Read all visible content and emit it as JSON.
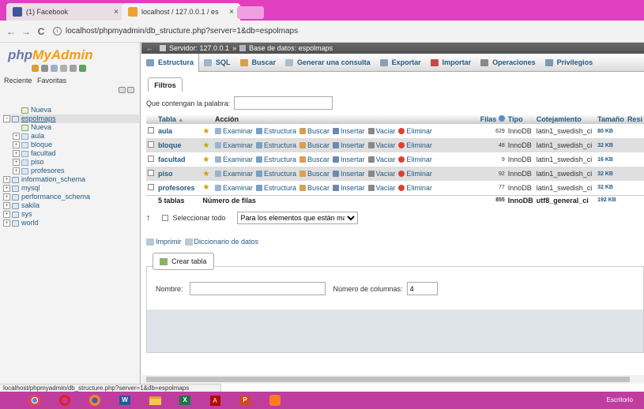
{
  "browser": {
    "tabs": [
      {
        "title": "(1) Facebook",
        "icon": "facebook-icon",
        "close": "×"
      },
      {
        "title": "localhost / 127.0.0.1 / es",
        "icon": "phpmyadmin-icon",
        "close": "×"
      }
    ],
    "url": "localhost/phpmyadmin/db_structure.php?server=1&db=espolmaps",
    "back": "←",
    "forward": "→",
    "reload": "C",
    "info": "i"
  },
  "nav": {
    "logo_php": "php",
    "logo_myadmin": "MyAdmin",
    "recent_label": "Reciente",
    "favorites_label": "Favoritas",
    "tree": [
      {
        "label": "Nueva",
        "level": 1,
        "expander": "",
        "type": "new"
      },
      {
        "label": "espolmaps",
        "level": 1,
        "expander": "−",
        "type": "db",
        "selected": true
      },
      {
        "label": "Nueva",
        "level": 2,
        "expander": "",
        "type": "new"
      },
      {
        "label": "aula",
        "level": 2,
        "expander": "+",
        "type": "table"
      },
      {
        "label": "bloque",
        "level": 2,
        "expander": "+",
        "type": "table"
      },
      {
        "label": "facultad",
        "level": 2,
        "expander": "+",
        "type": "table"
      },
      {
        "label": "piso",
        "level": 2,
        "expander": "+",
        "type": "table"
      },
      {
        "label": "profesores",
        "level": 2,
        "expander": "+",
        "type": "table"
      },
      {
        "label": "information_schema",
        "level": 1,
        "expander": "+",
        "type": "db"
      },
      {
        "label": "mysql",
        "level": 1,
        "expander": "+",
        "type": "db"
      },
      {
        "label": "performance_schema",
        "level": 1,
        "expander": "+",
        "type": "db"
      },
      {
        "label": "sakila",
        "level": 1,
        "expander": "+",
        "type": "db"
      },
      {
        "label": "sys",
        "level": 1,
        "expander": "+",
        "type": "db"
      },
      {
        "label": "world",
        "level": 1,
        "expander": "+",
        "type": "db"
      }
    ]
  },
  "breadcrumb": {
    "server": "Servidor: 127.0.0.1",
    "sep": "»",
    "database": "Base de datos: espolmaps"
  },
  "menu": [
    {
      "label": "Estructura",
      "active": true,
      "icon": "structure-icon",
      "color": "#7aa0c4"
    },
    {
      "label": "SQL",
      "active": false,
      "icon": "sql-icon",
      "color": "#9cb6cf"
    },
    {
      "label": "Buscar",
      "active": false,
      "icon": "search-icon",
      "color": "#d8a050"
    },
    {
      "label": "Generar una consulta",
      "active": false,
      "icon": "query-icon",
      "color": "#b0bcc8"
    },
    {
      "label": "Exportar",
      "active": false,
      "icon": "export-icon",
      "color": "#8aa0b8"
    },
    {
      "label": "Importar",
      "active": false,
      "icon": "import-icon",
      "color": "#c84848"
    },
    {
      "label": "Operaciones",
      "active": false,
      "icon": "wrench-icon",
      "color": "#8a8a8a"
    },
    {
      "label": "Privilegios",
      "active": false,
      "icon": "privileges-icon",
      "color": "#7a9ab8"
    }
  ],
  "filters": {
    "legend": "Filtros",
    "label": "Que contengan la palabra:",
    "value": ""
  },
  "table": {
    "headers": {
      "name": "Tabla",
      "sort_arrow": "▲",
      "action": "Acción",
      "rows": "Filas",
      "type": "Tipo",
      "collation": "Cotejamiento",
      "size": "Tamaño",
      "overhead": "Resi"
    },
    "actions": {
      "browse": "Examinar",
      "structure": "Estructura",
      "search": "Buscar",
      "insert": "Insertar",
      "empty": "Vaciar",
      "drop": "Eliminar"
    },
    "rows": [
      {
        "name": "aula",
        "rows": "629",
        "engine": "InnoDB",
        "collation": "latin1_swedish_ci",
        "size": "80 KB"
      },
      {
        "name": "bloque",
        "rows": "48",
        "engine": "InnoDB",
        "collation": "latin1_swedish_ci",
        "size": "32 KB"
      },
      {
        "name": "facultad",
        "rows": "9",
        "engine": "InnoDB",
        "collation": "latin1_swedish_ci",
        "size": "16 KB"
      },
      {
        "name": "piso",
        "rows": "92",
        "engine": "InnoDB",
        "collation": "latin1_swedish_ci",
        "size": "32 KB"
      },
      {
        "name": "profesores",
        "rows": "77",
        "engine": "InnoDB",
        "collation": "latin1_swedish_ci",
        "size": "32 KB"
      }
    ],
    "footer": {
      "count": "5 tablas",
      "label": "Número de filas",
      "rows": "855",
      "engine": "InnoDB",
      "collation": "utf8_general_ci",
      "size": "192 KB"
    }
  },
  "bulk": {
    "arrow": "↑",
    "select_all": "Seleccionar todo",
    "with_selected": "Para los elementos que están marcados:"
  },
  "links": {
    "print": "Imprimir",
    "dictionary": "Diccionario de datos"
  },
  "create": {
    "legend": "Crear tabla",
    "name_label": "Nombre:",
    "name_value": "",
    "cols_label": "Número de columnas:",
    "cols_value": "4"
  },
  "statusbar": {
    "url": "localhost/phpmyadmin/db_structure.php?server=1&db=espolmaps"
  },
  "taskbar": {
    "desktop_label": "Escritorio",
    "apps": [
      "chrome-icon",
      "opera-icon",
      "firefox-icon",
      "word-icon",
      "file-explorer-icon",
      "excel-icon",
      "acrobat-icon",
      "powerpoint-icon",
      "xampp-icon"
    ]
  }
}
